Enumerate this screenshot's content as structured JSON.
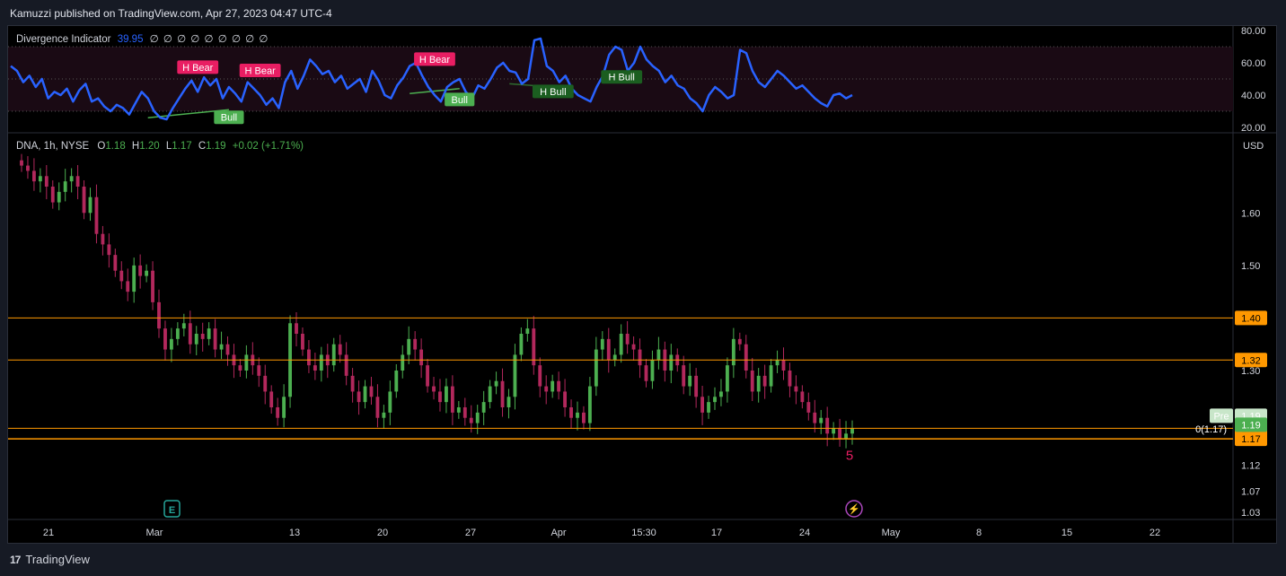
{
  "header": {
    "publisher_text": "Kamuzzi published on TradingView.com, Apr 27, 2023 04:47 UTC-4"
  },
  "footer": {
    "brand_icon": "tradingview-logo-icon",
    "brand_text": "TradingView"
  },
  "indicator_legend": {
    "name": "Divergence Indicator",
    "value": "39.95",
    "empty_values": "∅ ∅ ∅ ∅ ∅ ∅ ∅ ∅ ∅"
  },
  "price_legend": {
    "symbol": "DNA, 1h, NYSE",
    "open_label": "O",
    "open": "1.18",
    "high_label": "H",
    "high": "1.20",
    "low_label": "L",
    "low": "1.17",
    "close_label": "C",
    "close": "1.19",
    "change": "+0.02 (+1.71%)"
  },
  "colors": {
    "up": "#4caf50",
    "down": "#b2285c",
    "rsi_line": "#2962ff",
    "level_line": "#ff9800",
    "bear_label": "#e91e63",
    "bull_label": "#4caf50",
    "hbull_label": "#1b5e20",
    "bg": "#000000"
  },
  "chart_data": [
    {
      "type": "line",
      "series": [
        {
          "name": "Divergence Indicator",
          "values": [
            58,
            55,
            48,
            52,
            45,
            50,
            38,
            42,
            40,
            44,
            36,
            43,
            47,
            36,
            38,
            33,
            30,
            34,
            32,
            28,
            35,
            42,
            38,
            30,
            26,
            25,
            32,
            38,
            44,
            49,
            42,
            51,
            46,
            50,
            38,
            45,
            41,
            36,
            48,
            44,
            40,
            34,
            38,
            32,
            48,
            55,
            44,
            52,
            62,
            58,
            53,
            55,
            48,
            52,
            44,
            47,
            50,
            42,
            55,
            49,
            40,
            38,
            46,
            51,
            58,
            60,
            52,
            45,
            40,
            36,
            45,
            48,
            50,
            42,
            38,
            46,
            44,
            50,
            57,
            60,
            55,
            54,
            47,
            50,
            74,
            75,
            58,
            55,
            48,
            52,
            44,
            40,
            38,
            36,
            45,
            52,
            65,
            70,
            68,
            55,
            60,
            70,
            62,
            58,
            55,
            48,
            52,
            46,
            44,
            38,
            35,
            30,
            40,
            45,
            42,
            38,
            40,
            68,
            66,
            55,
            48,
            45,
            50,
            55,
            52,
            48,
            44,
            46,
            42,
            38,
            35,
            33,
            40,
            41,
            38,
            40
          ]
        }
      ],
      "ylim": [
        20,
        80
      ],
      "y_ticks": [
        "80.00",
        "60.00",
        "40.00",
        "20.00"
      ],
      "levels": [
        70,
        50,
        30
      ],
      "annotations": [
        {
          "text": "H Bear",
          "kind": "bear",
          "index": 30,
          "value": 57
        },
        {
          "text": "H Bear",
          "kind": "bear",
          "index": 40,
          "value": 55
        },
        {
          "text": "Bull",
          "kind": "bull",
          "index": 35,
          "value": 26
        },
        {
          "text": "H Bear",
          "kind": "bear",
          "index": 68,
          "value": 62
        },
        {
          "text": "Bull",
          "kind": "bull",
          "index": 72,
          "value": 37
        },
        {
          "text": "H Bull",
          "kind": "hbull",
          "index": 87,
          "value": 42
        },
        {
          "text": "H Bull",
          "kind": "hbull",
          "index": 98,
          "value": 51
        }
      ],
      "divergence_lines": [
        {
          "kind": "bull",
          "from": [
            22,
            26
          ],
          "to": [
            35,
            31
          ]
        },
        {
          "kind": "bull",
          "from": [
            64,
            41
          ],
          "to": [
            72,
            44
          ]
        },
        {
          "kind": "hbull",
          "from": [
            80,
            47
          ],
          "to": [
            87,
            45
          ]
        }
      ]
    },
    {
      "type": "candlestick",
      "currency": "USD",
      "close": [
        1.69,
        1.68,
        1.66,
        1.67,
        1.65,
        1.62,
        1.64,
        1.66,
        1.67,
        1.65,
        1.6,
        1.63,
        1.56,
        1.54,
        1.52,
        1.49,
        1.47,
        1.45,
        1.5,
        1.48,
        1.49,
        1.43,
        1.38,
        1.34,
        1.36,
        1.38,
        1.39,
        1.35,
        1.37,
        1.36,
        1.38,
        1.34,
        1.35,
        1.33,
        1.31,
        1.3,
        1.33,
        1.31,
        1.29,
        1.26,
        1.23,
        1.21,
        1.25,
        1.39,
        1.37,
        1.34,
        1.31,
        1.3,
        1.33,
        1.31,
        1.35,
        1.33,
        1.29,
        1.26,
        1.24,
        1.27,
        1.25,
        1.21,
        1.22,
        1.26,
        1.3,
        1.33,
        1.36,
        1.34,
        1.31,
        1.27,
        1.26,
        1.24,
        1.27,
        1.22,
        1.23,
        1.21,
        1.2,
        1.22,
        1.24,
        1.27,
        1.28,
        1.23,
        1.25,
        1.33,
        1.37,
        1.38,
        1.31,
        1.27,
        1.26,
        1.28,
        1.26,
        1.23,
        1.21,
        1.22,
        1.2,
        1.27,
        1.34,
        1.36,
        1.32,
        1.33,
        1.37,
        1.35,
        1.34,
        1.31,
        1.28,
        1.32,
        1.34,
        1.3,
        1.33,
        1.31,
        1.27,
        1.29,
        1.25,
        1.22,
        1.24,
        1.25,
        1.26,
        1.31,
        1.36,
        1.35,
        1.3,
        1.26,
        1.29,
        1.27,
        1.31,
        1.32,
        1.3,
        1.27,
        1.26,
        1.24,
        1.22,
        1.2,
        1.21,
        1.18,
        1.19,
        1.17,
        1.18,
        1.19
      ],
      "ylim": [
        1.02,
        1.72
      ],
      "y_ticks": [
        "1.60",
        "1.50",
        "1.30",
        "1.12",
        "1.07",
        "1.03"
      ],
      "horizontal_levels": [
        {
          "value": 1.4,
          "label": "1.40"
        },
        {
          "value": 1.32,
          "label": "1.32"
        },
        {
          "value": 1.19,
          "label": "1.19"
        },
        {
          "value": 1.17,
          "label": "1.17"
        }
      ],
      "price_tags": [
        {
          "label": "Pre",
          "value": "1.19"
        },
        {
          "label": "",
          "value": "1.19"
        }
      ],
      "fib_label": "0(1.17)",
      "wave_label": "5",
      "x_ticks": [
        "21",
        "Mar",
        "13",
        "20",
        "27",
        "Apr",
        "15:30",
        "17",
        "24",
        "May",
        "8",
        "15",
        "22"
      ],
      "event_markers": [
        {
          "icon": "earnings-e-icon",
          "text": "E"
        },
        {
          "icon": "lightning-icon",
          "text": "⚡"
        }
      ]
    }
  ]
}
